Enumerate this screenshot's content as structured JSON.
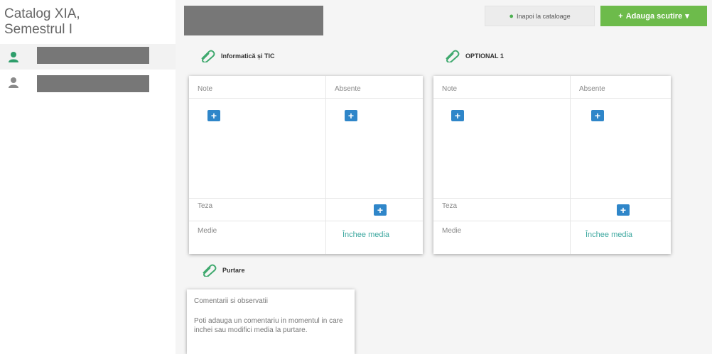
{
  "sidebar": {
    "title_line1": "Catalog XIA,",
    "title_line2": "Semestrul I",
    "students": [
      {
        "name": "",
        "active": true
      },
      {
        "name": "",
        "active": false
      }
    ]
  },
  "header": {
    "import_label": "Inapoi la cataloage",
    "add_label": "Adauga scutire",
    "add_chevron": "▾"
  },
  "subjects": [
    {
      "name": "Informatică și TIC",
      "col_grades": "Note",
      "col_absences": "Absente",
      "row_thesis": "Teza",
      "row_average": "Medie",
      "close_average": "Închee media"
    },
    {
      "name": "OPTIONAL 1",
      "col_grades": "Note",
      "col_absences": "Absente",
      "row_thesis": "Teza",
      "row_average": "Medie",
      "close_average": "Închee media"
    }
  ],
  "conduct": {
    "title": "Purtare",
    "comments_head": "Comentarii si observatii",
    "comments_body": "Poti adauga un comentariu in momentul in care inchei sau modifici media la purtare."
  },
  "icons": {
    "plus": "+",
    "student": "user-icon",
    "clip": "paperclip-icon"
  },
  "colors": {
    "accent_green": "#6dbb4b",
    "plus_blue": "#2f86c9",
    "link_teal": "#3ea8a0"
  }
}
